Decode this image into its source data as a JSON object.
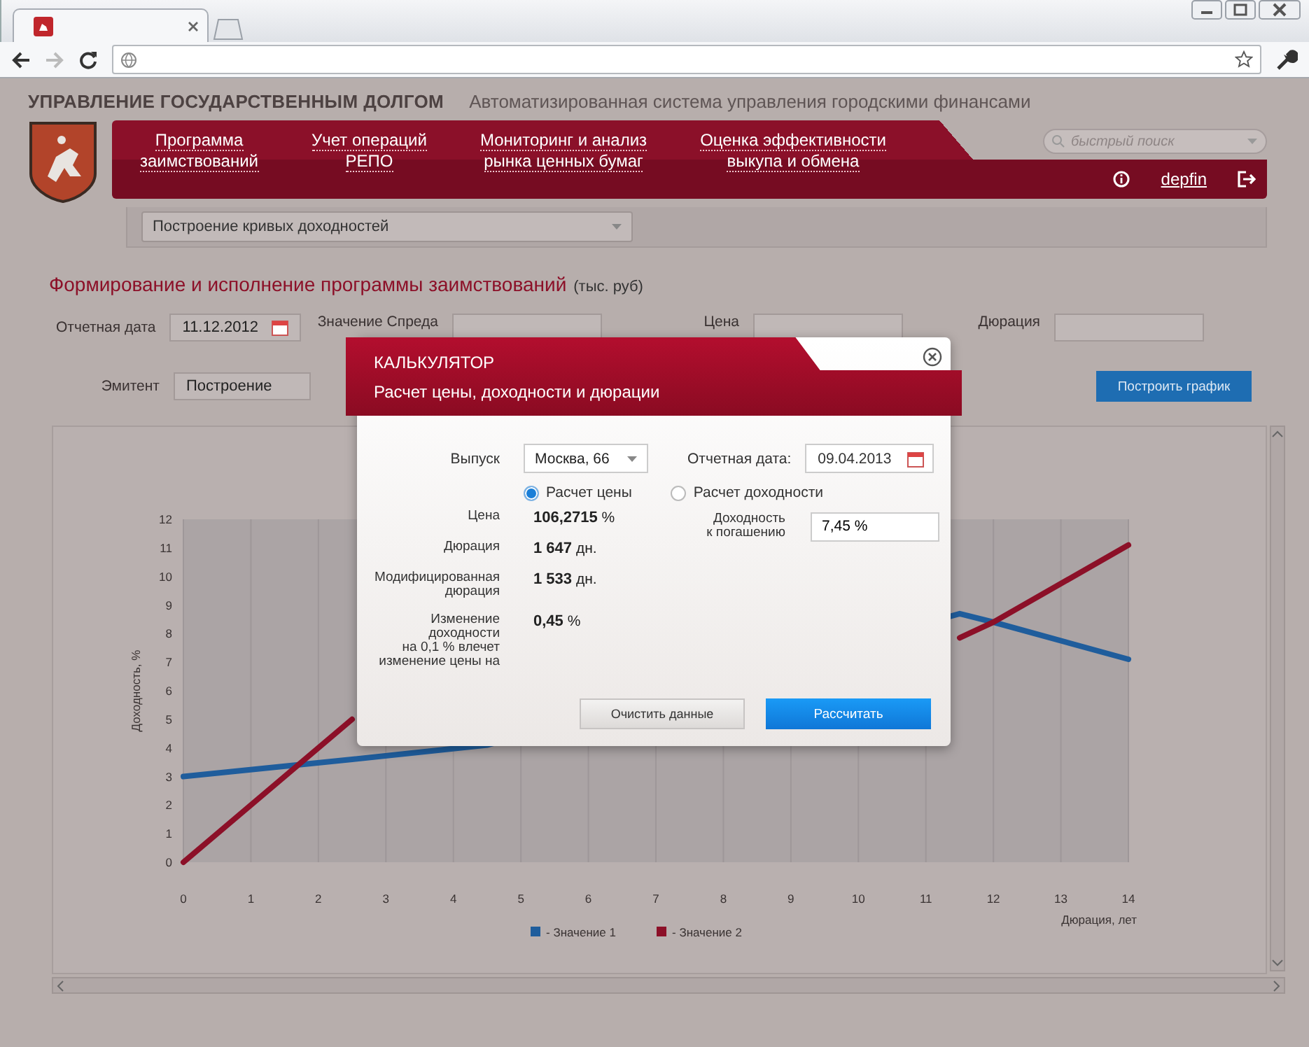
{
  "header": {
    "title": "УПРАВЛЕНИЕ ГОСУДАРСТВЕННЫМ ДОЛГОМ",
    "subtitle": "Автоматизированная система управления городскими финансами"
  },
  "nav": [
    {
      "lines": [
        "Программа",
        "заимствований"
      ]
    },
    {
      "lines": [
        "Учет операций",
        "РЕПО"
      ]
    },
    {
      "lines": [
        "Мониторинг и анализ",
        "рынка ценных бумаг"
      ]
    },
    {
      "lines": [
        "Оценка эффективности",
        "выкупа и обмена"
      ]
    }
  ],
  "search": {
    "placeholder": "быстрый поиск"
  },
  "user": "depfin",
  "section_select": "Построение кривых доходностей",
  "page": {
    "heading": "Формирование и исполнение программы заимствований",
    "unit": "(тыс. руб)"
  },
  "filters": [
    {
      "label": "Отчетная дата",
      "value": "11.12.2012",
      "kind": "date"
    },
    {
      "label": "Значение Спреда",
      "kind": "text"
    },
    {
      "label": "Цена",
      "kind": "text"
    },
    {
      "label": "Дюрация",
      "kind": "text"
    },
    {
      "label": "Эмитент",
      "value": "Построение",
      "kind": "select"
    }
  ],
  "build_button": "Построить график",
  "chart": {
    "chart_data": {
      "type": "line",
      "xlabel": "Дюрация, лет",
      "ylabel": "Доходность, %",
      "x": [
        0,
        2.5,
        4.5,
        11.5,
        12,
        14
      ],
      "series": [
        {
          "name": "- Значение 1",
          "color": "#1f5d9c",
          "values": [
            3,
            3.6,
            4.1,
            8.7,
            8.4,
            7.1
          ]
        },
        {
          "name": "- Значение 2",
          "color": "#8c1028",
          "values": [
            0,
            5,
            null,
            7.85,
            8.4,
            11.1
          ]
        }
      ],
      "grid": true,
      "legend": true,
      "xlim": [
        0,
        14
      ],
      "ylim": [
        0,
        12
      ],
      "xticks": [
        0,
        1,
        2,
        3,
        4,
        5,
        6,
        7,
        8,
        9,
        10,
        11,
        12,
        13,
        14
      ],
      "yticks": [
        0,
        1,
        2,
        3,
        4,
        5,
        6,
        7,
        8,
        9,
        10,
        11,
        12
      ]
    }
  },
  "modal": {
    "title": "КАЛЬКУЛЯТОР",
    "subtitle": "Расчет цены, доходности и дюрации",
    "issue": {
      "label": "Выпуск",
      "value": "Москва, 66"
    },
    "date": {
      "label": "Отчетная дата:",
      "value": "09.04.2013"
    },
    "modes": [
      {
        "label": "Расчет цены",
        "selected": true
      },
      {
        "label": "Расчет доходности",
        "selected": false
      }
    ],
    "results": [
      {
        "label": [
          "Цена"
        ],
        "value": "**106,2715** %"
      },
      {
        "label": [
          "Дюрация"
        ],
        "value": "**1 647** дн."
      },
      {
        "label": [
          "Модифицированная",
          "дюрация"
        ],
        "value": "**1 533** дн."
      },
      {
        "label": [
          "Изменение",
          "доходности",
          "на 0,1 % влечет",
          "изменение цены на"
        ],
        "value": "**0,45** %"
      }
    ],
    "yield": {
      "label": [
        "Доходность",
        "к погашению"
      ],
      "value": "7,45 %"
    },
    "buttons": [
      {
        "label": "Очистить данные",
        "kind": "secondary"
      },
      {
        "label": "Рассчитать",
        "kind": "primary"
      }
    ]
  }
}
